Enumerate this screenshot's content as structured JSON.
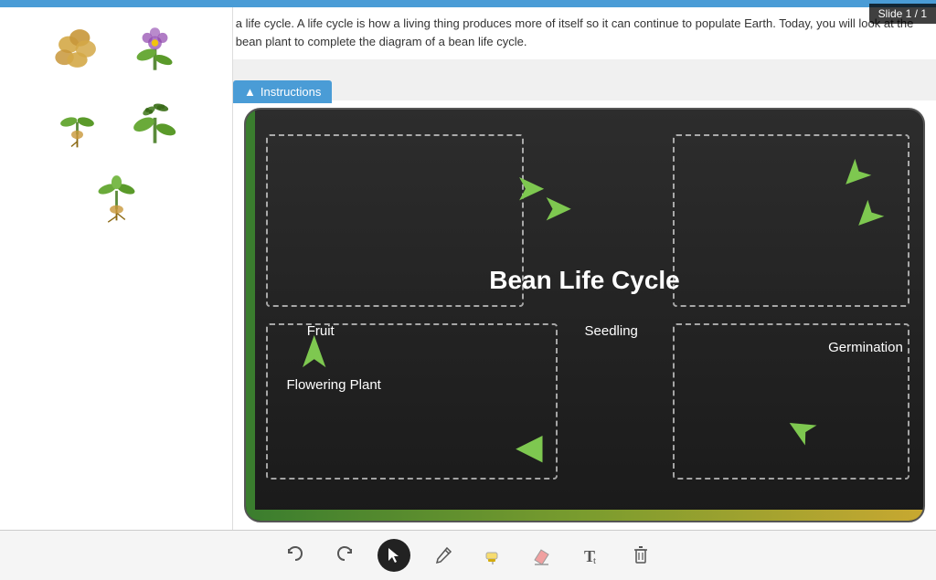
{
  "app": {
    "slide_indicator": "Slide 1 / 1"
  },
  "instructions": {
    "button_label": "Instructions",
    "text": "Just like humans or animals, plants have a life cycle. A life cycle is how a living thing produces more of itself so it can continue to populate Earth. Today, you will look at the life cycle of a bean. Use the pictures of a bean plant to complete the diagram of a bean life cycle."
  },
  "diagram": {
    "title": "Bean Life Cycle",
    "labels": {
      "fruit": "Fruit",
      "flowering_plant": "Flowering Plant",
      "seedling": "Seedling",
      "germination": "Germination"
    }
  },
  "toolbar": {
    "undo_label": "Undo",
    "redo_label": "Redo",
    "select_label": "Select",
    "pen_label": "Pen",
    "highlighter_label": "Highlighter",
    "eraser_label": "Eraser",
    "text_label": "Text",
    "delete_label": "Delete"
  }
}
